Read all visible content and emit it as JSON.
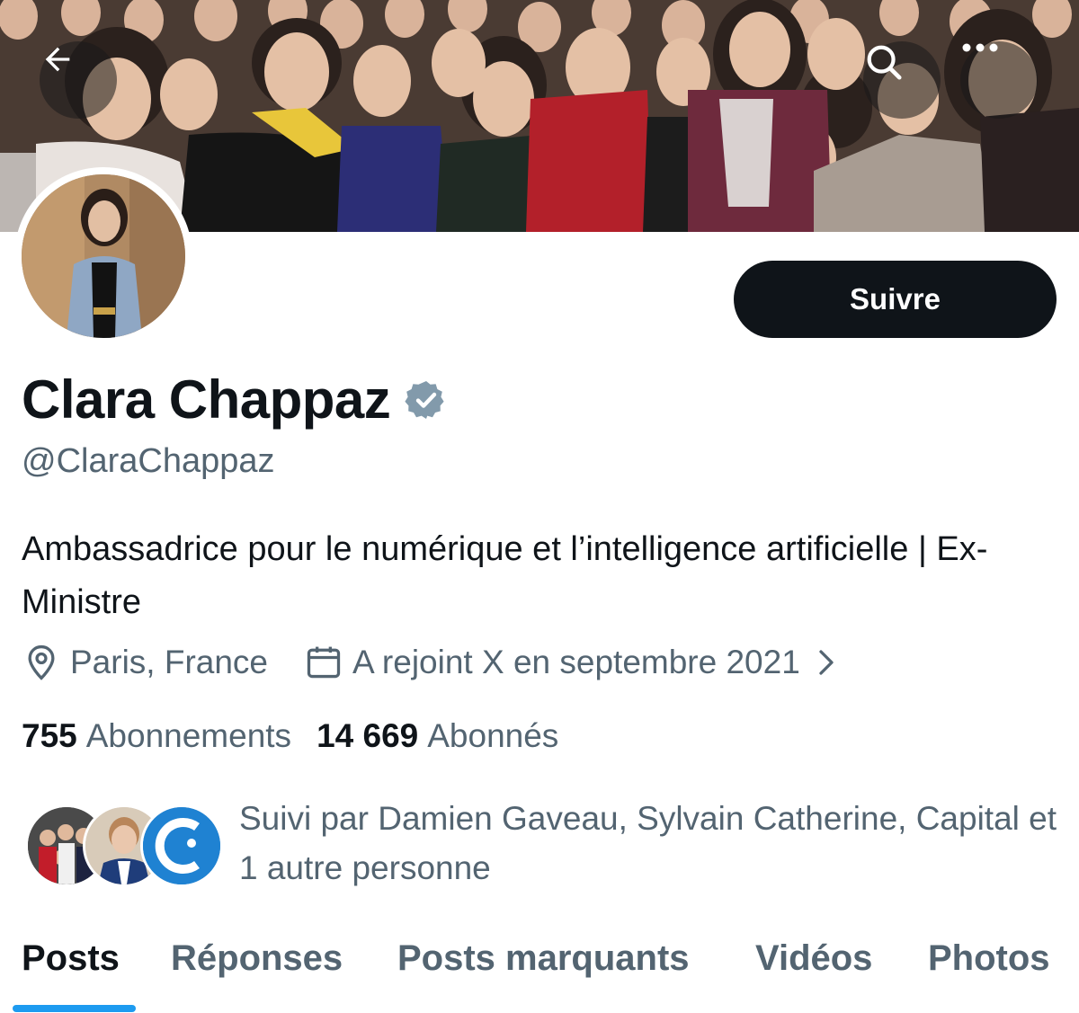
{
  "header": {
    "back_icon": "arrow-left-icon",
    "search_icon": "search-icon",
    "more_icon": "more-horizontal-icon"
  },
  "profile": {
    "display_name": "Clara Chappaz",
    "verified": true,
    "verified_color": "#829aab",
    "handle": "@ClaraChappaz",
    "bio": "Ambassadrice pour le numérique et l’intelligence artificielle | Ex-Ministre",
    "location": "Paris, France",
    "joined": "A rejoint X en septembre 2021",
    "follow_label": "Suivre"
  },
  "stats": {
    "following_count": "755",
    "following_label": "Abonnements",
    "followers_count": "14 669",
    "followers_label": "Abonnés"
  },
  "followed_by": {
    "text": "Suivi par Damien Gaveau, Sylvain Catherine, Capital et 1 autre personne"
  },
  "tabs": [
    {
      "label": "Posts",
      "active": true
    },
    {
      "label": "Réponses",
      "active": false
    },
    {
      "label": "Posts marquants",
      "active": false
    },
    {
      "label": "Vidéos",
      "active": false
    },
    {
      "label": "Photos",
      "active": false
    }
  ],
  "colors": {
    "accent": "#1d9bf0",
    "text_primary": "#0f1419",
    "text_secondary": "#536471",
    "button_bg": "#0f1419"
  }
}
